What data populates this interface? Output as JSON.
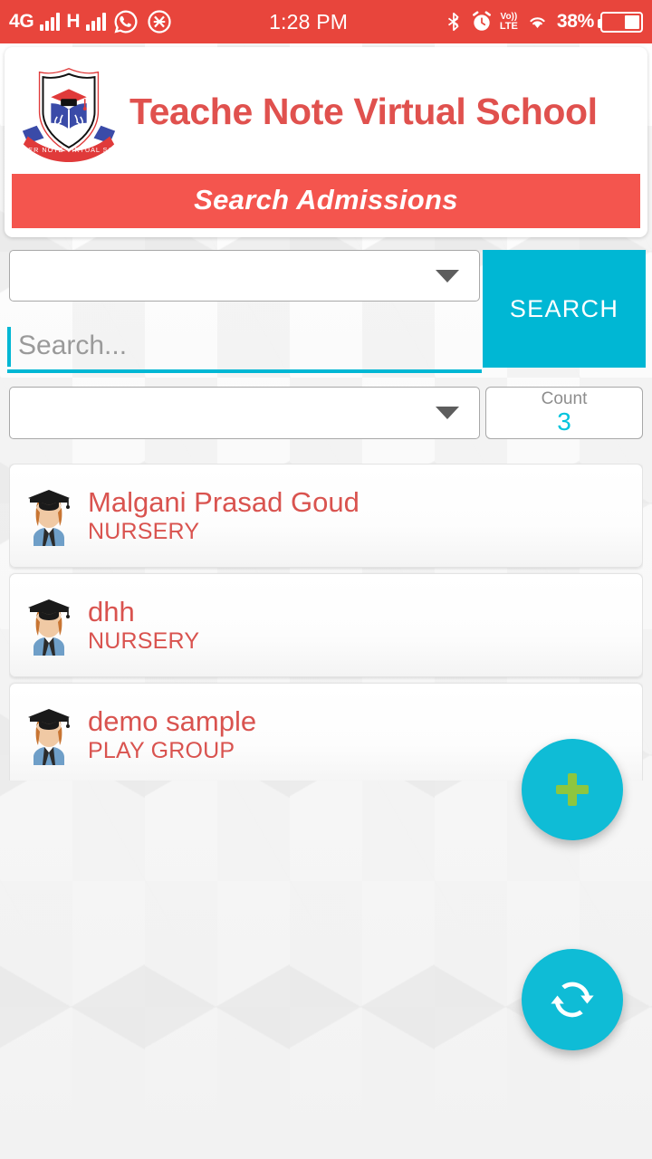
{
  "status_bar": {
    "network_type": "4G",
    "network_type_2": "H",
    "time": "1:28 PM",
    "volte_top": "Vo))",
    "volte_bottom": "LTE",
    "battery_percent": "38%",
    "icons": [
      "signal-bars-icon",
      "signal-bars-icon",
      "whatsapp-icon",
      "no-disturb-icon",
      "bluetooth-icon",
      "alarm-clock-icon",
      "volte-icon",
      "wifi-icon",
      "battery-icon"
    ],
    "background_color": "#e8453c"
  },
  "header": {
    "title": "Teache Note Virtual School",
    "logo_banner_text": "TEACHER NOTE VIRTUAL SCHOOL",
    "banner_label": "Search Admissions",
    "title_color": "#e0514e",
    "banner_color": "#f4554e"
  },
  "filters": {
    "dropdown_1_value": "",
    "dropdown_2_value": "",
    "search_placeholder": "Search...",
    "search_value": "",
    "search_button_label": "SEARCH",
    "count_label": "Count",
    "count_value": "3",
    "accent_color": "#00b7d4"
  },
  "results": {
    "items": [
      {
        "name": "Malgani Prasad Goud",
        "class": "NURSERY"
      },
      {
        "name": "dhh",
        "class": "NURSERY"
      },
      {
        "name": "demo sample",
        "class": "PLAY GROUP"
      }
    ],
    "text_color": "#d9534f"
  },
  "fabs": {
    "add_icon": "plus-icon",
    "refresh_icon": "refresh-icon",
    "color": "#0fbcd6"
  }
}
